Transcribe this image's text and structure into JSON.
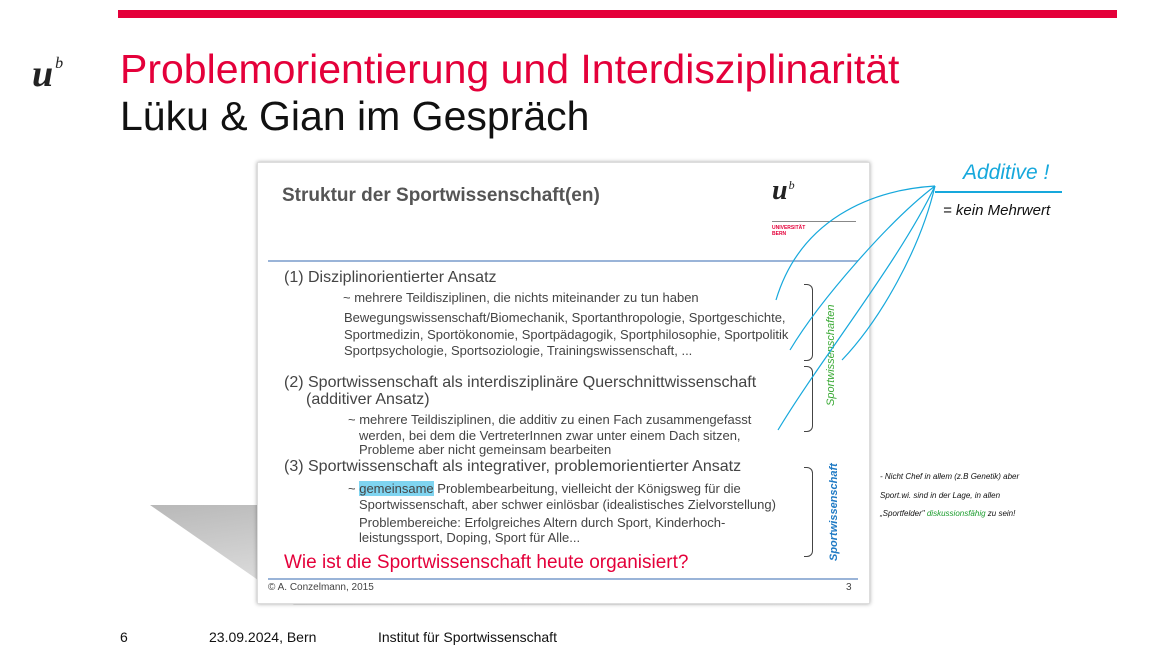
{
  "header": {
    "logo_u": "u",
    "logo_b": "b",
    "title": "Problemorientierung und Interdisziplinarität",
    "subtitle": "Lüku & Gian im Gespräch"
  },
  "slide": {
    "title": "Struktur der Sportwissenschaft(en)",
    "logo_u": "u",
    "logo_b": "b",
    "logo_text_line1": "UNIVERSITÄT",
    "logo_text_line2": "BERN",
    "item1_heading": "(1) Disziplinorientierter Ansatz",
    "item1_sub": "~ mehrere Teildisziplinen, die nichts miteinander zu tun haben",
    "item1_list_1": "Bewegungswissenschaft/Biomechanik, Sportanthropologie, Sportgeschichte,",
    "item1_list_2": "Sportmedizin, Sportökonomie, Sportpädagogik, Sportphilosophie, Sportpolitik",
    "item1_list_3": "Sportpsychologie, Sportsoziologie, Trainingswissenschaft, ...",
    "item2_heading_1": "(2) Sportwissenschaft als interdisziplinäre Querschnittwissenschaft",
    "item2_heading_2": "(additiver Ansatz)",
    "item2_sub_1": "~ mehrere Teildisziplinen, die additiv zu einen Fach zusammengefasst",
    "item2_sub_2": "werden, bei dem die VertreterInnen zwar unter einem Dach sitzen,",
    "item2_sub_3": "Probleme aber nicht gemeinsam bearbeiten",
    "item3_heading": "(3) Sportwissenschaft als integrativer, problemorientierter Ansatz",
    "item3_sub_prefix": "~ ",
    "item3_sub_highlight": "gemeinsame",
    "item3_sub_rest": " Problembearbeitung, vielleicht der Königsweg für die",
    "item3_sub_2": "Sportwissenschaft, aber schwer einlösbar (idealistisches Zielvorstellung)",
    "item3_problems_1": "Problembereiche: Erfolgreiches Altern durch Sport, Kinderhoch-",
    "item3_problems_2": "leistungssport, Doping, Sport für Alle...",
    "question": "Wie ist die Sportwissenschaft heute organisiert?",
    "vertical_label_1": "Sportwissenschaften",
    "vertical_label_2": "Sportwissenschaft",
    "footer_left": "© A. Conzelmann, 2015",
    "footer_right": "3",
    "colors": {
      "green": "#3aa935",
      "blue": "#1f7ac4"
    }
  },
  "annotations": {
    "additive": "Additive !",
    "mehrwert": "= kein Mehrwert",
    "note_line1": "- Nicht Chef in allem (z.B Genetik) aber",
    "note_line2": "Sport.wi. sind in der Lage, in allen",
    "note_line3_prefix": "„Sportfelder\" ",
    "note_line3_green": "diskussionsfähig",
    "note_line3_suffix": " zu sein!",
    "pen_color": "#16a8dc"
  },
  "footer": {
    "page": "6",
    "date_place": "23.09.2024, Bern",
    "institute": "Institut für Sportwissenschaft"
  },
  "theme": {
    "accent": "#e4003a"
  }
}
